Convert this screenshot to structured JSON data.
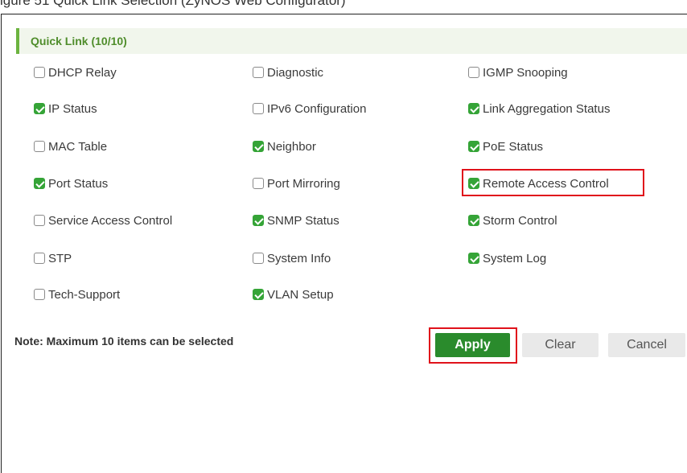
{
  "caption": "igure 51   Quick Link Selection (ZyNOS Web Configurator)",
  "panel": {
    "title": "Quick Link (10/10)"
  },
  "items": [
    {
      "label": "DHCP Relay",
      "checked": false
    },
    {
      "label": "Diagnostic",
      "checked": false
    },
    {
      "label": "IGMP Snooping",
      "checked": false
    },
    {
      "label": "IP Status",
      "checked": true
    },
    {
      "label": "IPv6 Configuration",
      "checked": false
    },
    {
      "label": "Link Aggregation Status",
      "checked": true
    },
    {
      "label": "MAC Table",
      "checked": false
    },
    {
      "label": "Neighbor",
      "checked": true
    },
    {
      "label": "PoE Status",
      "checked": true
    },
    {
      "label": "Port Status",
      "checked": true
    },
    {
      "label": "Port Mirroring",
      "checked": false
    },
    {
      "label": "Remote Access Control",
      "checked": true
    },
    {
      "label": "Service Access Control",
      "checked": false
    },
    {
      "label": "SNMP Status",
      "checked": true
    },
    {
      "label": "Storm Control",
      "checked": true
    },
    {
      "label": "STP",
      "checked": false
    },
    {
      "label": "System Info",
      "checked": false
    },
    {
      "label": "System Log",
      "checked": true
    },
    {
      "label": "Tech-Support",
      "checked": false
    },
    {
      "label": "VLAN Setup",
      "checked": true
    }
  ],
  "note": "Note: Maximum 10 items can be selected",
  "buttons": {
    "apply": "Apply",
    "clear": "Clear",
    "cancel": "Cancel"
  },
  "colors": {
    "accent": "#6cb33f",
    "checked": "#35a437",
    "apply": "#2a8b2c",
    "highlight": "#e0121b"
  }
}
